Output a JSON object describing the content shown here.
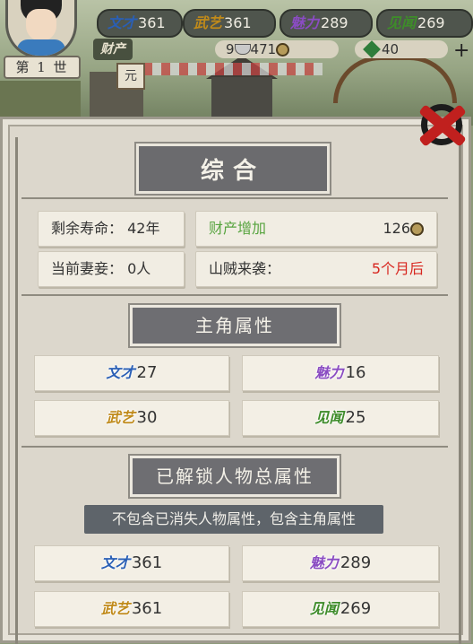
{
  "hud": {
    "generation": "第 1 世",
    "stats": [
      {
        "key": "文才",
        "value": "361"
      },
      {
        "key": "武艺",
        "value": "361"
      },
      {
        "key": "魅力",
        "value": "289"
      },
      {
        "key": "见闻",
        "value": "269"
      }
    ],
    "assets_label": "财产",
    "silver": "9",
    "copper": "471",
    "jade": "40"
  },
  "panel": {
    "title": "综合",
    "info": {
      "lifespan_label": "剩余寿命：",
      "lifespan_value": "42年",
      "wealth_label": "财产增加",
      "wealth_value": "126",
      "spouses_label": "当前妻妾：",
      "spouses_value": "0人",
      "bandit_label": "山贼来袭：",
      "bandit_value": "5个月后"
    },
    "hero_title": "主角属性",
    "hero_attrs": [
      {
        "key": "文才",
        "value": "27"
      },
      {
        "key": "魅力",
        "value": "16"
      },
      {
        "key": "武艺",
        "value": "30"
      },
      {
        "key": "见闻",
        "value": "25"
      }
    ],
    "total_title": "已解锁人物总属性",
    "total_note": "不包含已消失人物属性，包含主角属性",
    "total_attrs": [
      {
        "key": "文才",
        "value": "361"
      },
      {
        "key": "魅力",
        "value": "289"
      },
      {
        "key": "武艺",
        "value": "361"
      },
      {
        "key": "见闻",
        "value": "269"
      }
    ]
  },
  "colors": {
    "wealth_text": "#57a43f",
    "bandit_text": "#d8261f",
    "close_x": "#c0201e"
  }
}
